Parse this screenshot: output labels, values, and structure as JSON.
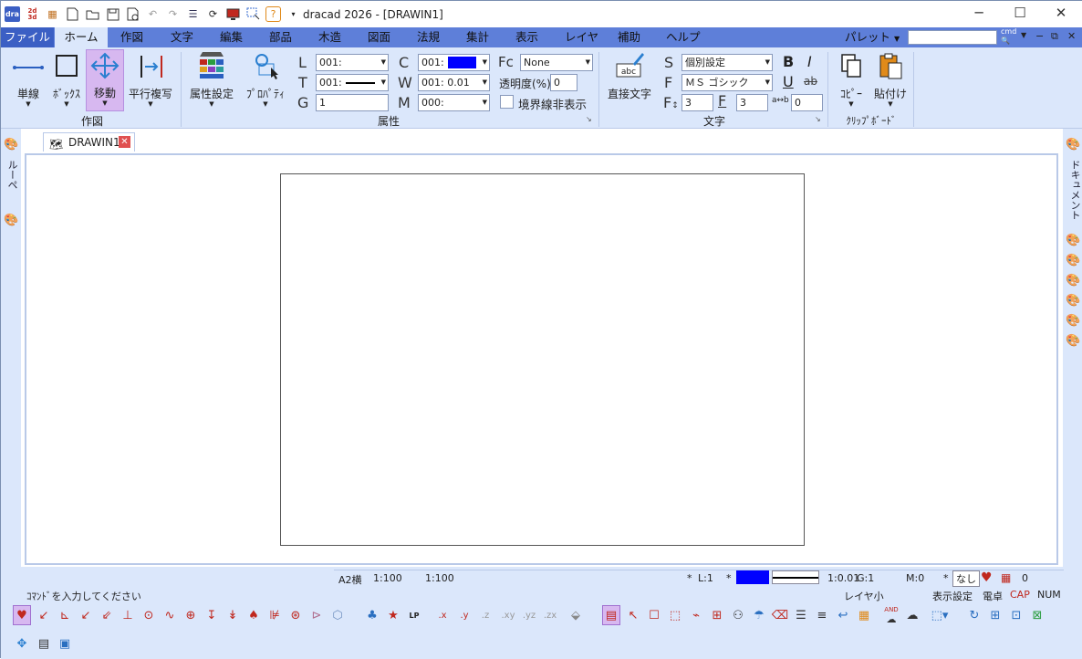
{
  "titlebar": {
    "app_title": "dracad 2026 - [DRAWIN1]",
    "minimize": "─",
    "maximize": "☐",
    "close": "✕"
  },
  "menu": {
    "file": "ファイル",
    "home": "ホーム",
    "tabs": [
      "作図",
      "文字",
      "編集",
      "部品",
      "木造",
      "図面",
      "法規",
      "集計",
      "表示",
      "レイヤ",
      "補助",
      "ヘルプ"
    ],
    "palette": "パレット",
    "cmd": "cmd"
  },
  "ribbon": {
    "draw_group": {
      "label": "作図",
      "buttons": [
        "単線",
        "ﾎﾞｯｸｽ",
        "移動",
        "平行複写"
      ]
    },
    "attr_group": {
      "label": "属性",
      "attr_set": "属性設定",
      "property": "ﾌﾟﾛﾊﾟﾃｨ",
      "L": {
        "label": "L",
        "value": "001:"
      },
      "T": {
        "label": "T",
        "value": "001:"
      },
      "G": {
        "label": "G",
        "value": "1"
      },
      "C": {
        "label": "C",
        "value": "001:",
        "color": "#0000ff"
      },
      "W": {
        "label": "W",
        "value": "001: 0.01"
      },
      "M": {
        "label": "M",
        "value": "000:"
      },
      "Fc": {
        "label": "Fc",
        "value": "None"
      },
      "transparency": {
        "label": "透明度(%)",
        "value": "0"
      },
      "hide_border": "境界線非表示"
    },
    "text_group": {
      "label": "文字",
      "direct_text": "直接文字",
      "abc": "abc",
      "S": {
        "label": "S",
        "value": "個別設定"
      },
      "F": {
        "label": "F",
        "value": "ＭＳ ゴシック"
      },
      "F2": {
        "label": "F",
        "value": "3"
      },
      "F3": {
        "label": "F",
        "value": "3"
      },
      "spacing": "0",
      "bold": "B",
      "italic": "I",
      "underline": "U",
      "strike": "ab"
    },
    "clip_group": {
      "label": "ｸﾘｯﾌﾟﾎﾞｰﾄﾞ",
      "copy": "ｺﾋﾟｰ",
      "paste": "貼付け"
    }
  },
  "document": {
    "tab_name": "DRAWIN1"
  },
  "side": {
    "left_label": "ルーペ",
    "right_label": "ドキュメント"
  },
  "status": {
    "paper": "A2横",
    "scale1": "1:100",
    "scale2": "1:100",
    "star1": "*",
    "layer": "L:1",
    "star2": "*",
    "line_scale": "1:0.01",
    "group": "G:1",
    "mode": "M:0",
    "star3": "*",
    "none": "なし",
    "count": "0",
    "prompt": "ｺﾏﾝﾄﾞを入力してください",
    "layer_small": "レイヤ小",
    "display_setting": "表示設定",
    "calc": "電卓",
    "cap": "CAP",
    "num": "NUM",
    "line_color": "#0000ff"
  },
  "toolbar": {
    "coords": [
      ".x",
      ".y",
      ".z",
      ".xy",
      ".yz",
      ".zx"
    ],
    "lp": "LP",
    "and": "AND"
  }
}
